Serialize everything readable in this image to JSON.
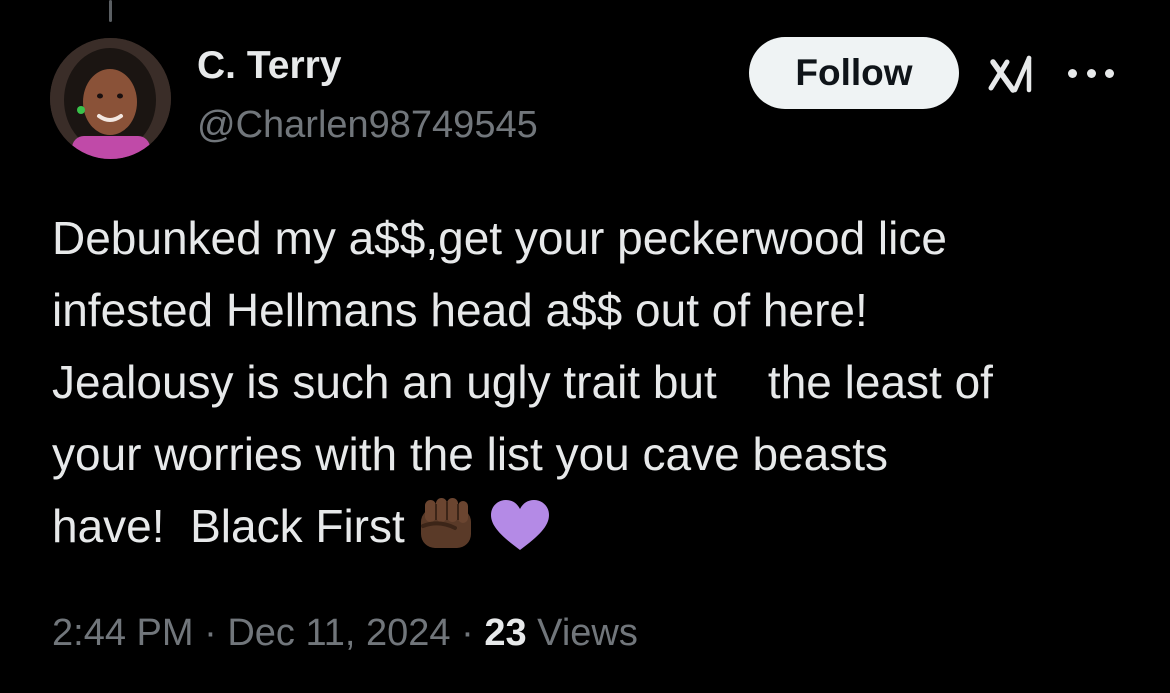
{
  "author": {
    "display_name": "C. Terry",
    "handle": "@Charlen98749545"
  },
  "follow_button_label": "Follow",
  "tweet": {
    "lines": [
      "Debunked my a$$,get your peckerwood lice",
      "infested Hellmans head a$$ out of here!",
      "Jealousy is such an ugly trait but    the least of",
      "your worries with the list you cave beasts",
      "have!  Black First"
    ],
    "emojis": [
      "raised-fist-dark-skin-tone",
      "purple-heart"
    ]
  },
  "meta": {
    "time": "2:44 PM",
    "separator": "·",
    "date": "Dec 11, 2024",
    "views_count": "23",
    "views_label": "Views"
  },
  "colors": {
    "background": "#000000",
    "primary_text": "#e7e9ea",
    "secondary_text": "#71767b",
    "follow_bg": "#eff3f4",
    "heart": "#b48ae6",
    "fist": "#5a3a28"
  },
  "icons": {
    "grok": "grok-icon",
    "more": "more-options-icon"
  }
}
